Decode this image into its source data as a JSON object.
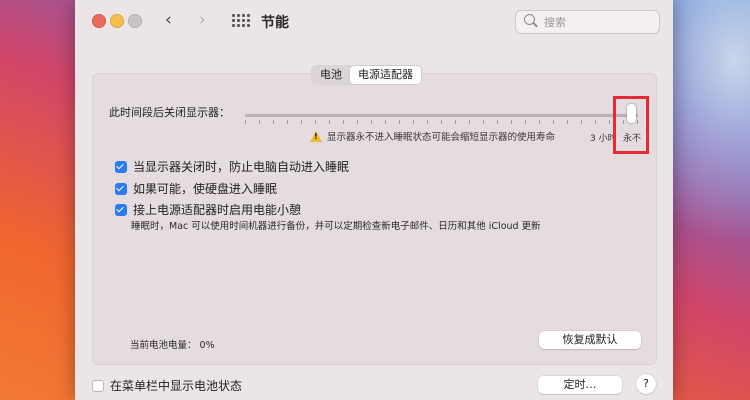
{
  "window": {
    "title": "节能",
    "back_icon": "‹",
    "forward_icon": "›",
    "search_placeholder": "搜索"
  },
  "tabs": [
    {
      "label": "电池",
      "active": false
    },
    {
      "label": "电源适配器",
      "active": true
    }
  ],
  "display_sleep": {
    "label": "此时间段后关闭显示器：",
    "slider_value": "永不",
    "warning": "显示器永不进入睡眠状态可能会缩短显示器的使用寿命",
    "tick_3h": "3 小时",
    "tick_never": "永不"
  },
  "checkboxes": [
    {
      "label": "当显示器关闭时，防止电脑自动进入睡眠",
      "checked": true
    },
    {
      "label": "如果可能，使硬盘进入睡眠",
      "checked": true
    },
    {
      "label": "接上电源适配器时启用电能小憩",
      "checked": true
    }
  ],
  "power_nap_note": "睡眠时，Mac 可以使用时间机器进行备份，并可以定期检查新电子邮件、日历和其他 iCloud 更新",
  "battery_level": "当前电池电量：  0%",
  "restore_defaults_label": "恢复成默认",
  "show_battery_status": {
    "label": "在菜单栏中显示电池状态",
    "checked": false
  },
  "schedule_label": "定时…",
  "help_label": "?",
  "colors": {
    "accent": "#2b7bf3",
    "highlight": "#e52b38",
    "warning": "#f3b92d"
  }
}
